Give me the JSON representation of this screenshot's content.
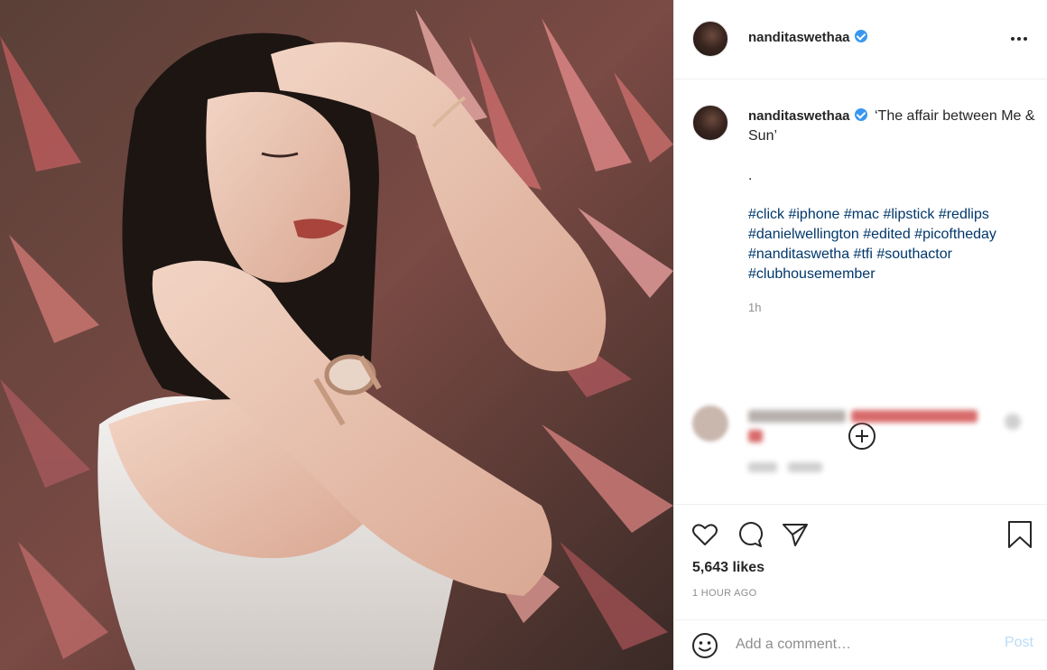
{
  "post": {
    "username": "nanditaswethaa",
    "verified": true,
    "caption_text": "‘The affair between Me & Sun’",
    "caption_dot": ".",
    "hashtags": [
      "#click",
      "#iphone",
      "#mac",
      "#lipstick",
      "#redlips",
      "#danielwellington",
      "#edited",
      "#picoftheday",
      "#nanditaswetha",
      "#tfi",
      "#southactor",
      "#clubhousemember"
    ],
    "caption_age": "1h",
    "likes": "5,643 likes",
    "posted_ago": "1 HOUR AGO"
  },
  "comment_box": {
    "placeholder": "Add a comment…",
    "post_label": "Post"
  },
  "icons": {
    "more": "more-options-icon",
    "load_more": "plus-circle-icon",
    "like": "heart-icon",
    "comment": "comment-bubble-icon",
    "share": "paper-plane-icon",
    "save": "bookmark-icon",
    "emoji": "smiley-icon",
    "verified": "verified-badge-icon"
  },
  "colors": {
    "link": "#00376b",
    "verified": "#3897f0",
    "muted": "#8e8e8e",
    "post_disabled": "#b9dcf8"
  }
}
